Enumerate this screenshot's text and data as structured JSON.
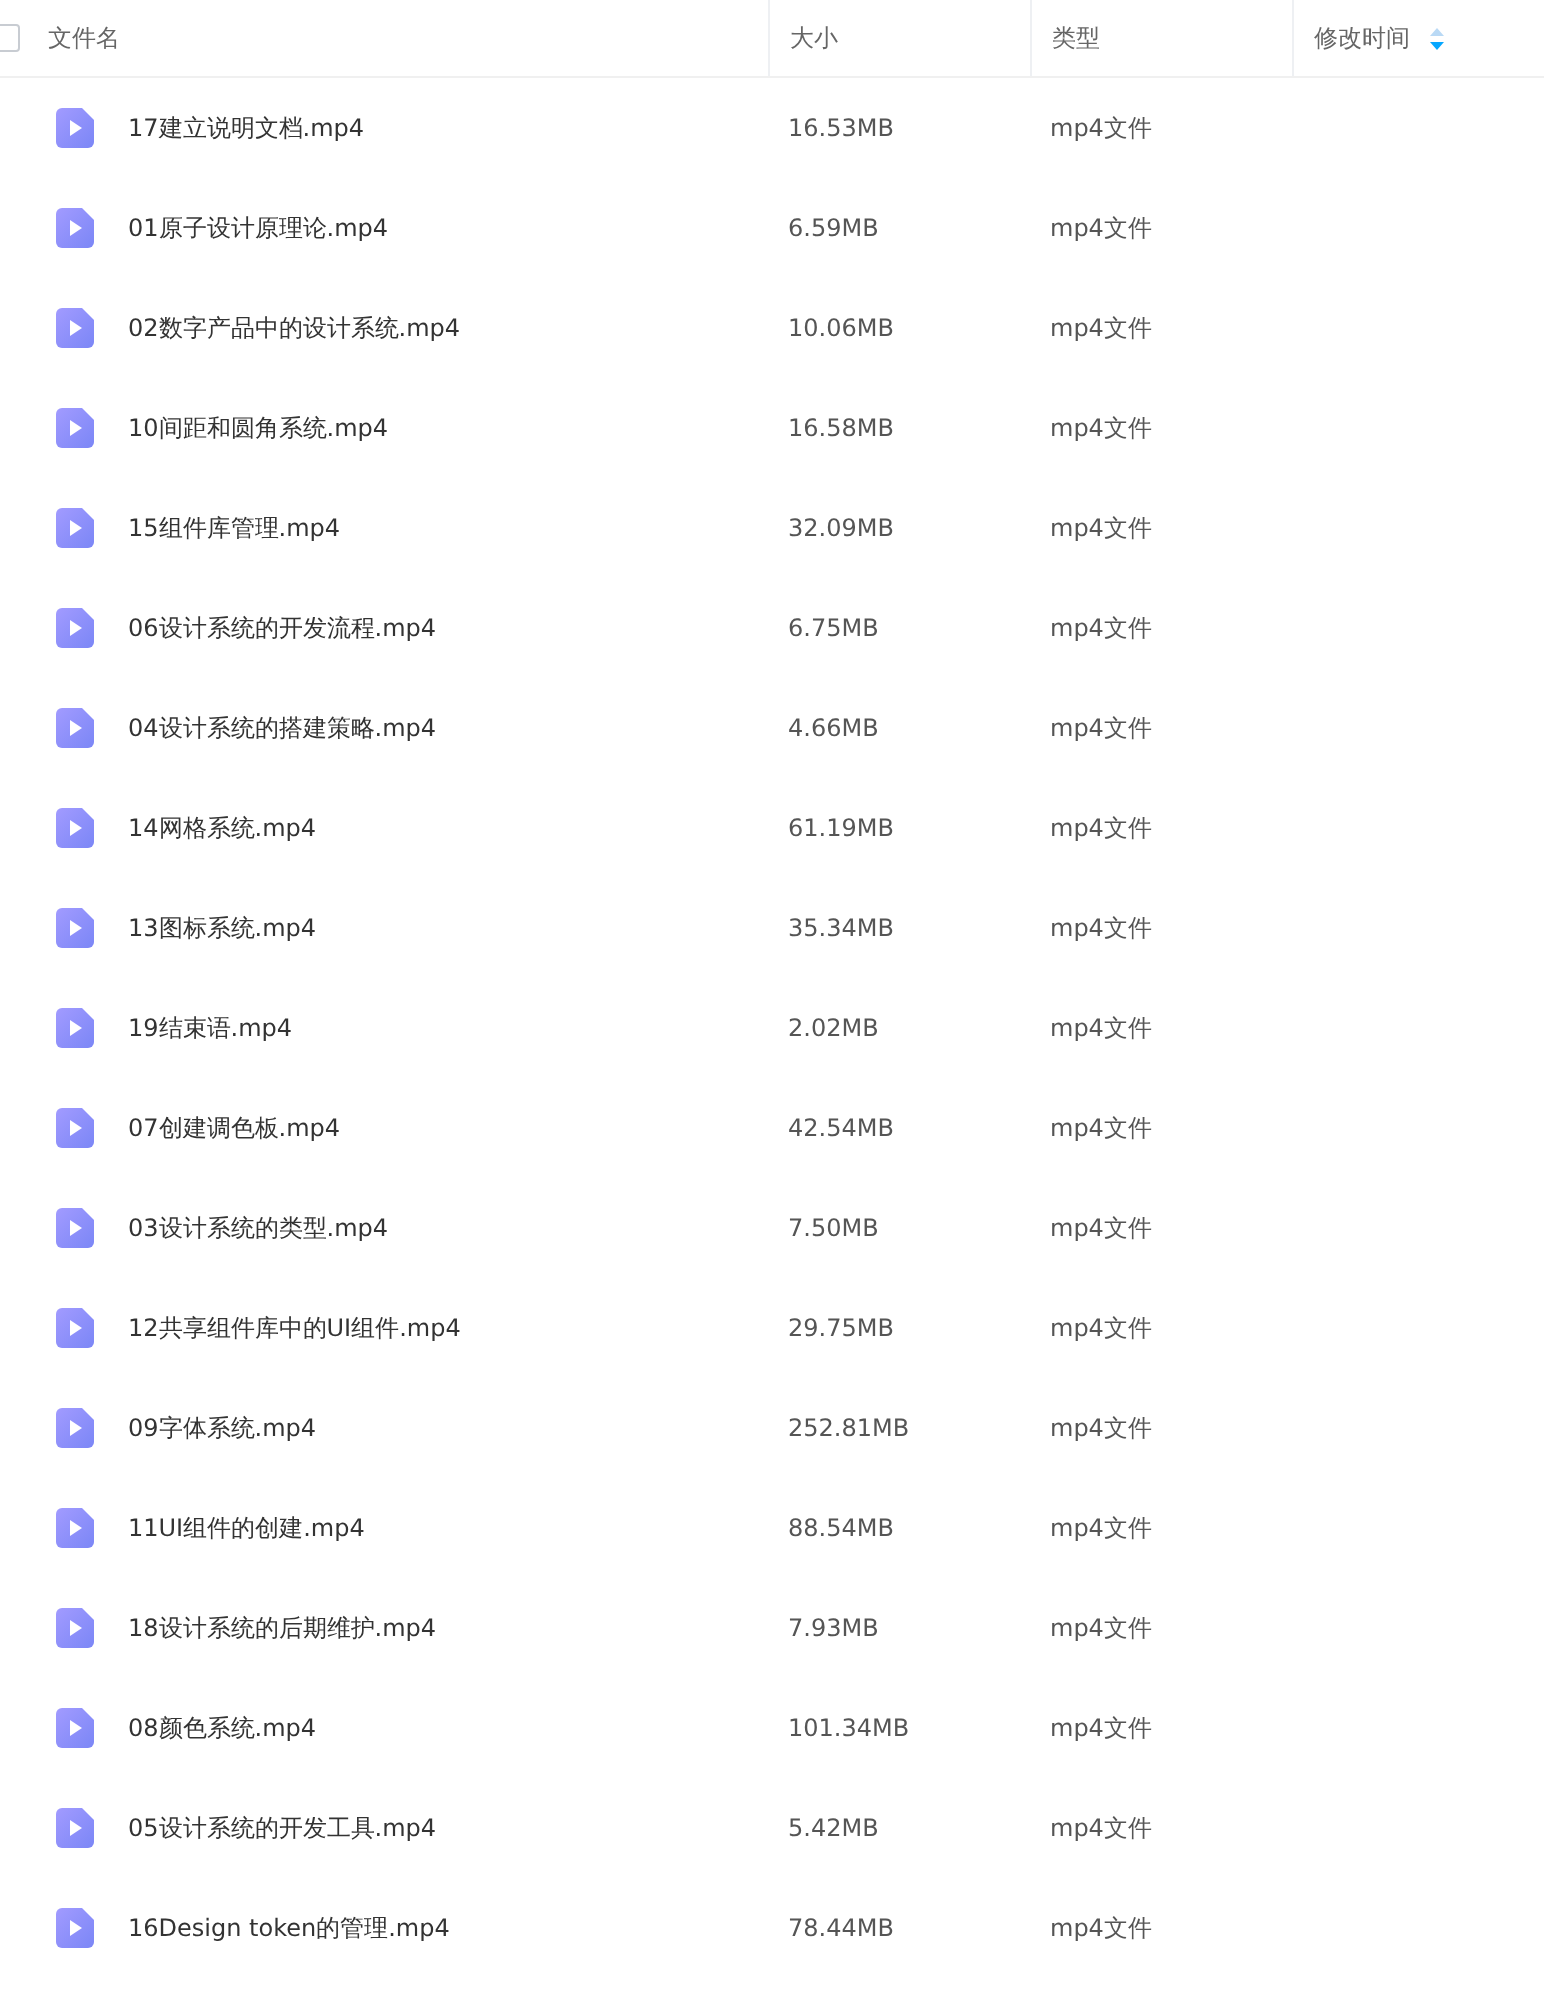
{
  "header": {
    "checked": false,
    "columns": [
      {
        "label": "文件名"
      },
      {
        "label": "大小"
      },
      {
        "label": "类型"
      },
      {
        "label": "修改时间",
        "sortable": true
      }
    ]
  },
  "rows": [
    {
      "name": "17建立说明文档.mp4",
      "size": "16.53MB",
      "type": "mp4文件"
    },
    {
      "name": "01原子设计原理论.mp4",
      "size": "6.59MB",
      "type": "mp4文件"
    },
    {
      "name": "02数字产品中的设计系统.mp4",
      "size": "10.06MB",
      "type": "mp4文件"
    },
    {
      "name": "10间距和圆角系统.mp4",
      "size": "16.58MB",
      "type": "mp4文件"
    },
    {
      "name": "15组件库管理.mp4",
      "size": "32.09MB",
      "type": "mp4文件"
    },
    {
      "name": "06设计系统的开发流程.mp4",
      "size": "6.75MB",
      "type": "mp4文件"
    },
    {
      "name": "04设计系统的搭建策略.mp4",
      "size": "4.66MB",
      "type": "mp4文件"
    },
    {
      "name": "14网格系统.mp4",
      "size": "61.19MB",
      "type": "mp4文件"
    },
    {
      "name": "13图标系统.mp4",
      "size": "35.34MB",
      "type": "mp4文件"
    },
    {
      "name": "19结束语.mp4",
      "size": "2.02MB",
      "type": "mp4文件"
    },
    {
      "name": "07创建调色板.mp4",
      "size": "42.54MB",
      "type": "mp4文件"
    },
    {
      "name": "03设计系统的类型.mp4",
      "size": "7.50MB",
      "type": "mp4文件"
    },
    {
      "name": "12共享组件库中的UI组件.mp4",
      "size": "29.75MB",
      "type": "mp4文件"
    },
    {
      "name": "09字体系统.mp4",
      "size": "252.81MB",
      "type": "mp4文件"
    },
    {
      "name": "11UI组件的创建.mp4",
      "size": "88.54MB",
      "type": "mp4文件"
    },
    {
      "name": "18设计系统的后期维护.mp4",
      "size": "7.93MB",
      "type": "mp4文件"
    },
    {
      "name": "08颜色系统.mp4",
      "size": "101.34MB",
      "type": "mp4文件"
    },
    {
      "name": "05设计系统的开发工具.mp4",
      "size": "5.42MB",
      "type": "mp4文件"
    },
    {
      "name": "16Design token的管理.mp4",
      "size": "78.44MB",
      "type": "mp4文件"
    }
  ]
}
